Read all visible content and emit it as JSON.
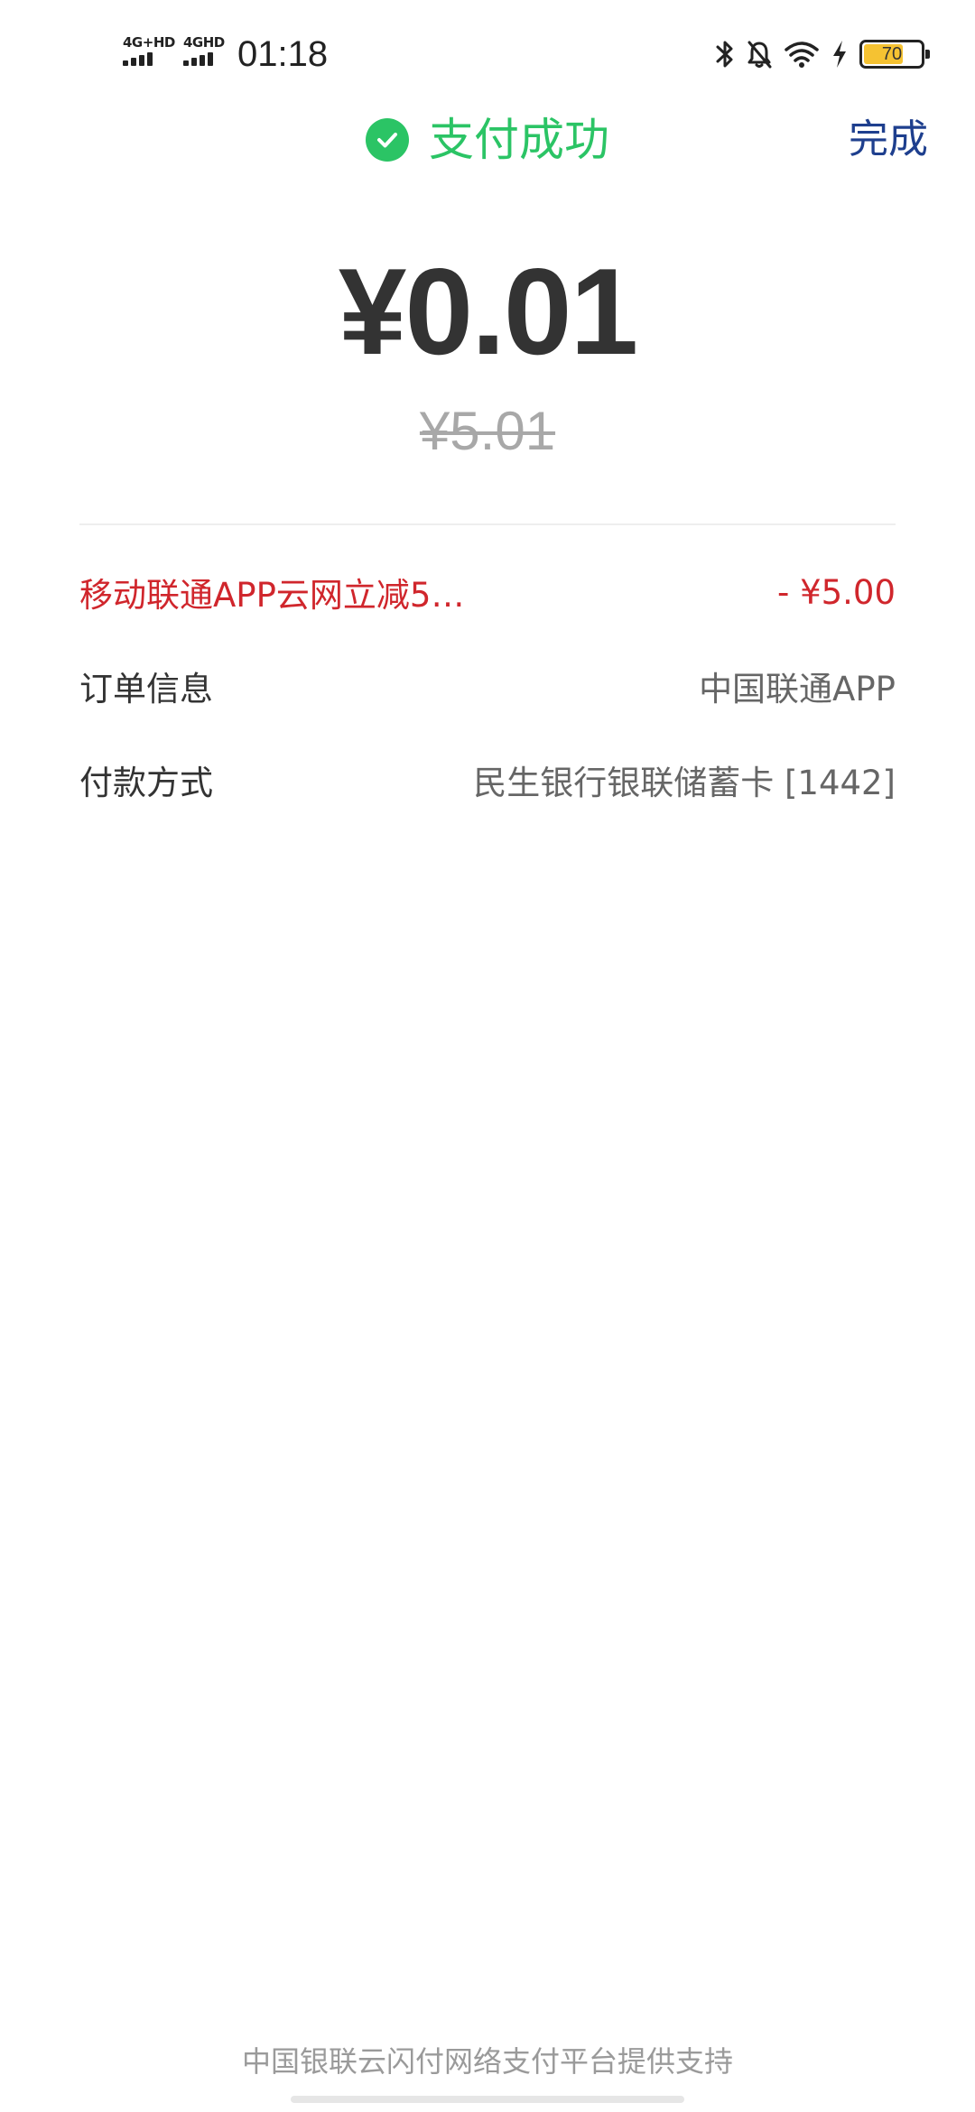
{
  "status_bar": {
    "sim1_label": "4G+HD",
    "sim2_label": "4GHD",
    "time": "01:18",
    "battery_level": "70",
    "icons": [
      "bluetooth-icon",
      "mute-bell-icon",
      "wifi-icon",
      "charging-icon",
      "battery-icon"
    ]
  },
  "header": {
    "title": "支付成功",
    "done_label": "完成",
    "icon": "check-circle-icon"
  },
  "amount": {
    "paid": "¥0.01",
    "original": "¥5.01"
  },
  "details": {
    "discount": {
      "label": "移动联通APP云网立减5…",
      "value": "- ¥5.00"
    },
    "order": {
      "label": "订单信息",
      "value": "中国联通APP"
    },
    "payment": {
      "label": "付款方式",
      "value": "民生银行银联储蓄卡 [1442]"
    }
  },
  "footer": {
    "text": "中国银联云闪付网络支付平台提供支持"
  },
  "colors": {
    "success_green": "#2bc465",
    "done_blue": "#1e3f8e",
    "discount_red": "#d0262c",
    "amount_dark": "#333333",
    "muted_gray": "#a8a8a8",
    "battery_yellow": "#f5c232"
  }
}
